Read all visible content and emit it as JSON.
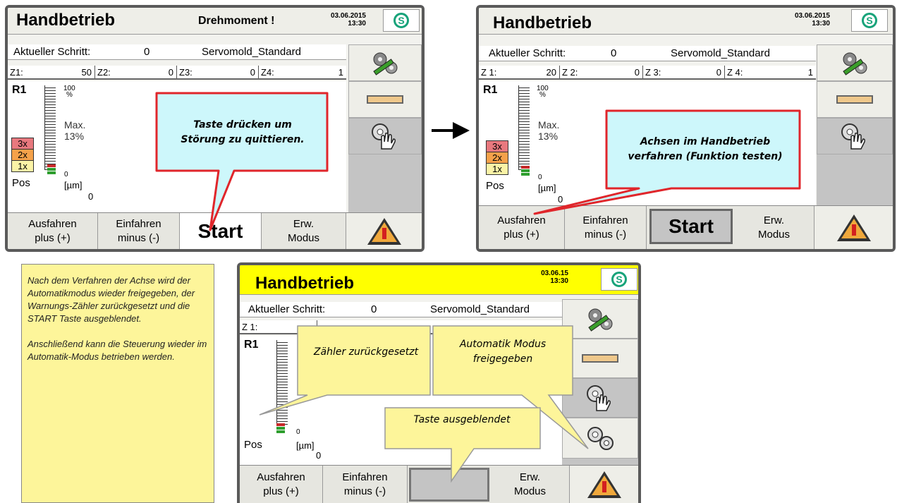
{
  "panels": {
    "p1": {
      "title": "Handbetrieb",
      "alarm": "Drehmoment !",
      "date": "03.06.2015",
      "time": "13:30",
      "step_label": "Aktueller Schritt:",
      "step_value": "0",
      "program": "Servomold_Standard",
      "zones": [
        {
          "label": "Z1:",
          "value": "50"
        },
        {
          "label": "Z2:",
          "value": "0"
        },
        {
          "label": "Z3:",
          "value": "0"
        },
        {
          "label": "Z4:",
          "value": "1"
        }
      ],
      "start_label": "Start"
    },
    "p2": {
      "title": "Handbetrieb",
      "date": "03.06.2015",
      "time": "13:30",
      "step_label": "Aktueller Schritt:",
      "step_value": "0",
      "program": "Servomold_Standard",
      "zones": [
        {
          "label": "Z 1:",
          "value": "20"
        },
        {
          "label": "Z 2:",
          "value": "0"
        },
        {
          "label": "Z 3:",
          "value": "0"
        },
        {
          "label": "Z 4:",
          "value": "1"
        }
      ],
      "start_label": "Start"
    },
    "p3": {
      "title": "Handbetrieb",
      "date": "03.06.15",
      "time": "13:30",
      "step_label": "Aktueller Schritt:",
      "step_value": "0",
      "program": "Servomold_Standard",
      "zone1_label": "Z 1:"
    }
  },
  "gauge": {
    "r1": "R1",
    "pct_top": "100",
    "pct_unit": "%",
    "max_label": "Max.",
    "max_value": "13%",
    "mult3": "3x",
    "mult2": "2x",
    "mult1": "1x",
    "zero": "0",
    "pos": "Pos",
    "um": "[µm]",
    "pos_value": "0"
  },
  "buttons": {
    "extend_1": "Ausfahren",
    "extend_2": "plus (+)",
    "retract_1": "Einfahren",
    "retract_2": "minus (-)",
    "ext_1": "Erw.",
    "ext_2": "Modus"
  },
  "icons": {
    "logo": "S",
    "side_top": "gears-wrench-icon",
    "side_mid": "ruler-icon",
    "side_hand": "gear-hand-icon",
    "side_auto": "gears-icon",
    "warning": "warning-triangle-icon",
    "arrow": "right-arrow-icon"
  },
  "callouts": {
    "c1": "Taste drücken um Störung zu quittieren.",
    "c2": "Achsen im Handbetrieb verfahren (Funktion testen)",
    "c3": "Zähler zurückgesetzt",
    "c4": "Automatik Modus freigegeben",
    "c5": "Taste ausgeblendet"
  },
  "note": {
    "p1": "Nach dem Verfahren der Achse wird der Automatikmodus wieder freigegeben, der Warnungs-Zähler zurückgesetzt und die START Taste ausgeblendet.",
    "p2": "Anschließend kann die Steuerung wieder im Automatik-Modus betrieben werden."
  },
  "colors": {
    "callout_blue": "#cdf7fb",
    "callout_border_red": "#e0262b",
    "callout_yellow": "#fdf59a",
    "header_yellow": "#ffff00"
  }
}
